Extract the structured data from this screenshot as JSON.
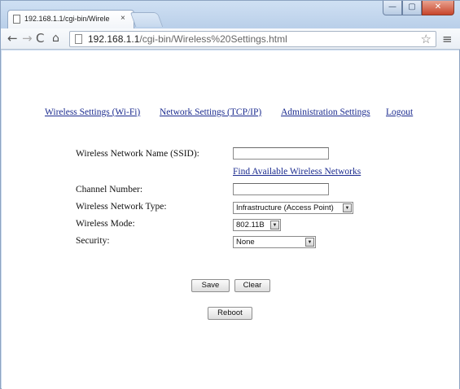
{
  "browser": {
    "tab_title": "192.168.1.1/cgi-bin/Wirele",
    "tab_close": "×",
    "url_host": "192.168.1.1",
    "url_path": "/cgi-bin/Wireless%20Settings.html",
    "window_controls": {
      "minimize": "—",
      "maximize": "▢",
      "close": "✕"
    },
    "icons": {
      "back": "←",
      "forward": "→",
      "reload": "C",
      "home": "⌂",
      "star": "☆",
      "menu": "≡"
    }
  },
  "nav": {
    "wireless": "Wireless Settings (Wi-Fi)",
    "network": "Network Settings (TCP/IP)",
    "admin": "Administration Settings",
    "logout": "Logout"
  },
  "form": {
    "ssid_label": "Wireless Network Name (SSID):",
    "ssid_value": "",
    "find_link": "Find Available Wireless Networks",
    "channel_label": "Channel Number:",
    "channel_value": "",
    "type_label": "Wireless Network Type:",
    "type_value": "Infrastructure (Access Point)",
    "mode_label": "Wireless Mode:",
    "mode_value": "802.11B",
    "security_label": "Security:",
    "security_value": "None",
    "dropdown_arrow": "▼"
  },
  "buttons": {
    "save": "Save",
    "clear": "Clear",
    "reboot": "Reboot"
  },
  "colors": {
    "link": "#1b2b8f",
    "chrome": "#c9dbef"
  }
}
